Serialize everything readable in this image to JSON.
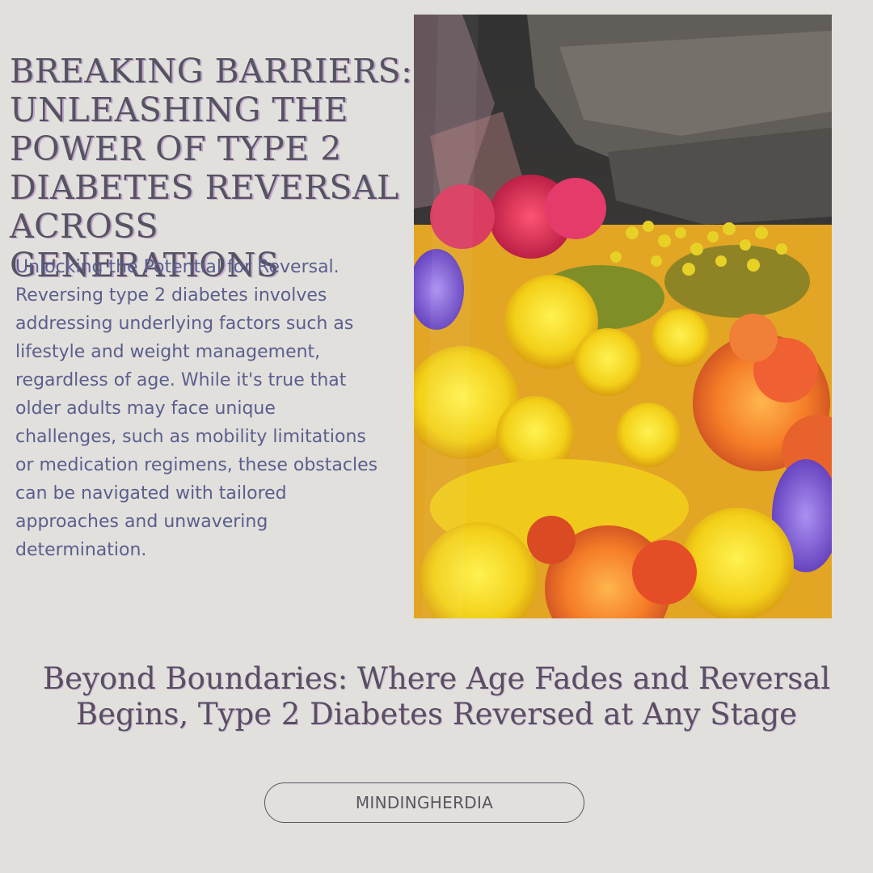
{
  "headline": "BREAKING BARRIERS: UNLEASHING THE POWER OF TYPE 2 DIABETES REVERSAL ACROSS GENERATIONS",
  "body": "Unlocking the Potential for Reversal. Reversing type 2 diabetes involves addressing underlying factors such as lifestyle and weight management, regardless of age. While it's true that older adults may face unique challenges, such as mobility limitations or medication regimens, these obstacles can be navigated with tailored approaches and unwavering determination.",
  "tagline": "Beyond Boundaries: Where Age Fades and Reversal Begins, Type 2 Diabetes Reversed at Any Stage",
  "brand": {
    "label": "MINDINGHERDIA"
  },
  "colors": {
    "background": "#e1e0dc",
    "headline": "#565361",
    "body": "#5b5e8e",
    "tagline": "#5a4e63",
    "pill_border": "#5a5660"
  }
}
